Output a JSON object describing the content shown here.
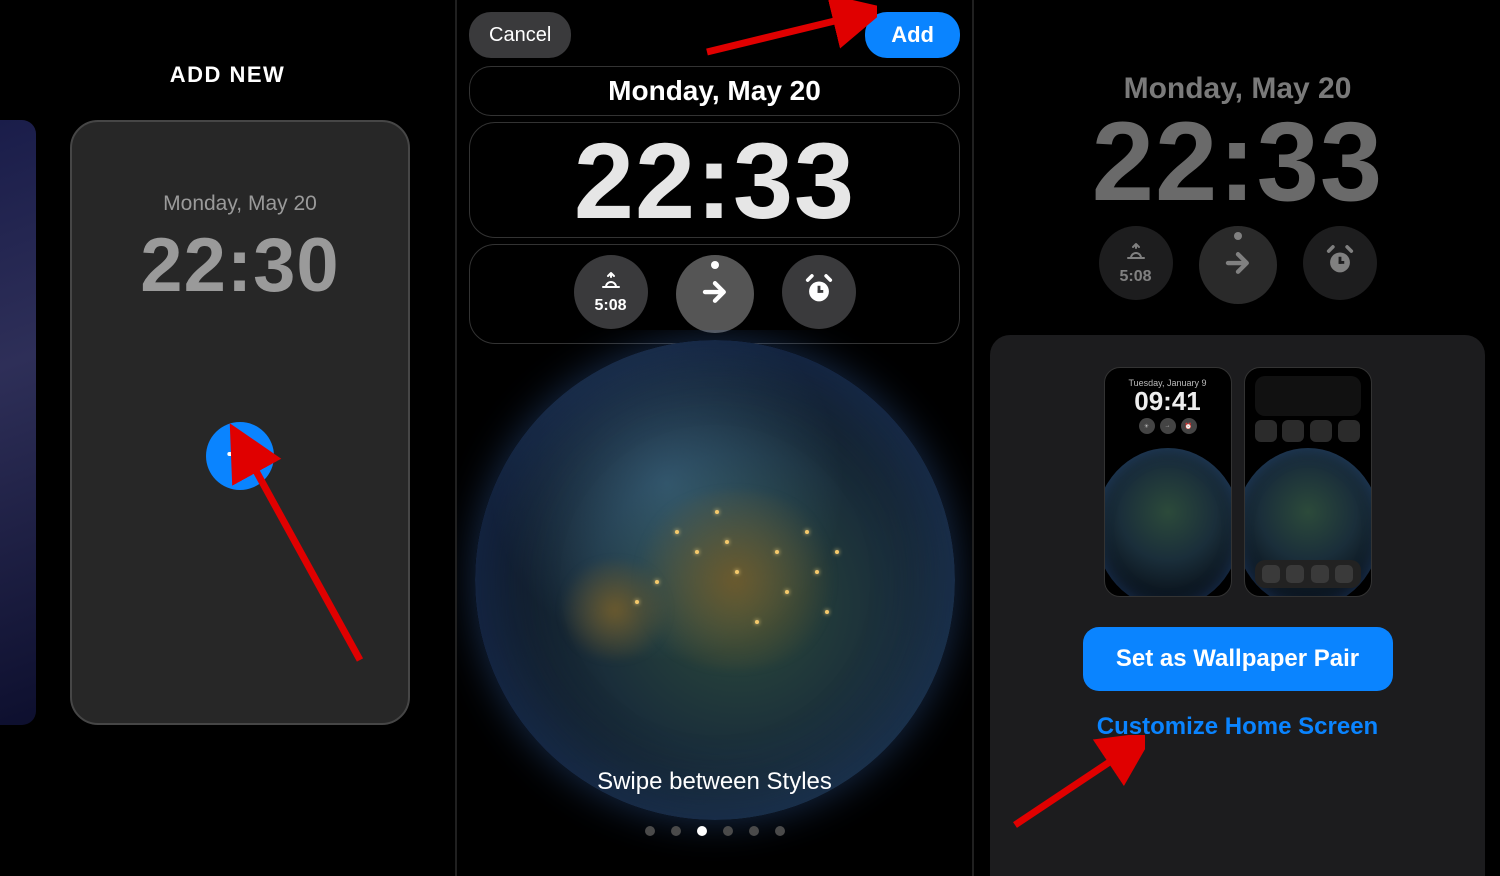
{
  "panel1": {
    "header": "ADD NEW",
    "card_date": "Monday, May 20",
    "card_time": "22:30"
  },
  "panel2": {
    "cancel": "Cancel",
    "add": "Add",
    "date": "Monday, May 20",
    "time": "22:33",
    "sunrise_time": "5:08",
    "swipe_hint": "Swipe between Styles",
    "page_dots_total": 6,
    "page_dots_active_index": 2
  },
  "panel3": {
    "date": "Monday, May 20",
    "time": "22:33",
    "sunrise_time": "5:08",
    "preview_lock_date": "Tuesday, January 9",
    "preview_lock_time": "09:41",
    "set_pair": "Set as Wallpaper Pair",
    "customize": "Customize Home Screen"
  }
}
